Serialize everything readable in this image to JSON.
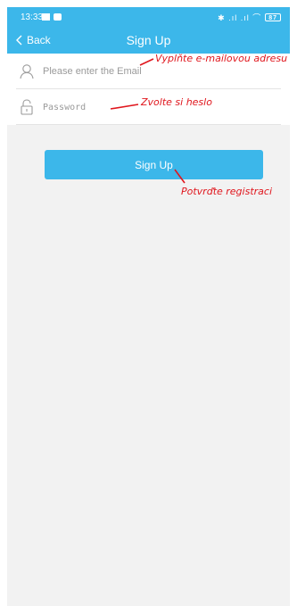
{
  "status_bar": {
    "time": "13:33",
    "right_icons": "✱ .ıl .ıl ⌒",
    "battery": "87"
  },
  "nav": {
    "back_label": "Back",
    "title": "Sign Up"
  },
  "form": {
    "email_placeholder": "Please enter the Email",
    "password_placeholder": "Password"
  },
  "signup_button": {
    "label": "Sign Up"
  },
  "annotations": {
    "email": "Vyplňte e-mailovou adresu",
    "password": "Zvolte si heslo",
    "signup": "Potvrďte registraci"
  },
  "colors": {
    "accent": "#3cb7ea",
    "annotation": "#e0161d",
    "background": "#f2f2f2"
  },
  "icons": [
    "back-chevron-icon",
    "user-icon",
    "lock-icon"
  ]
}
